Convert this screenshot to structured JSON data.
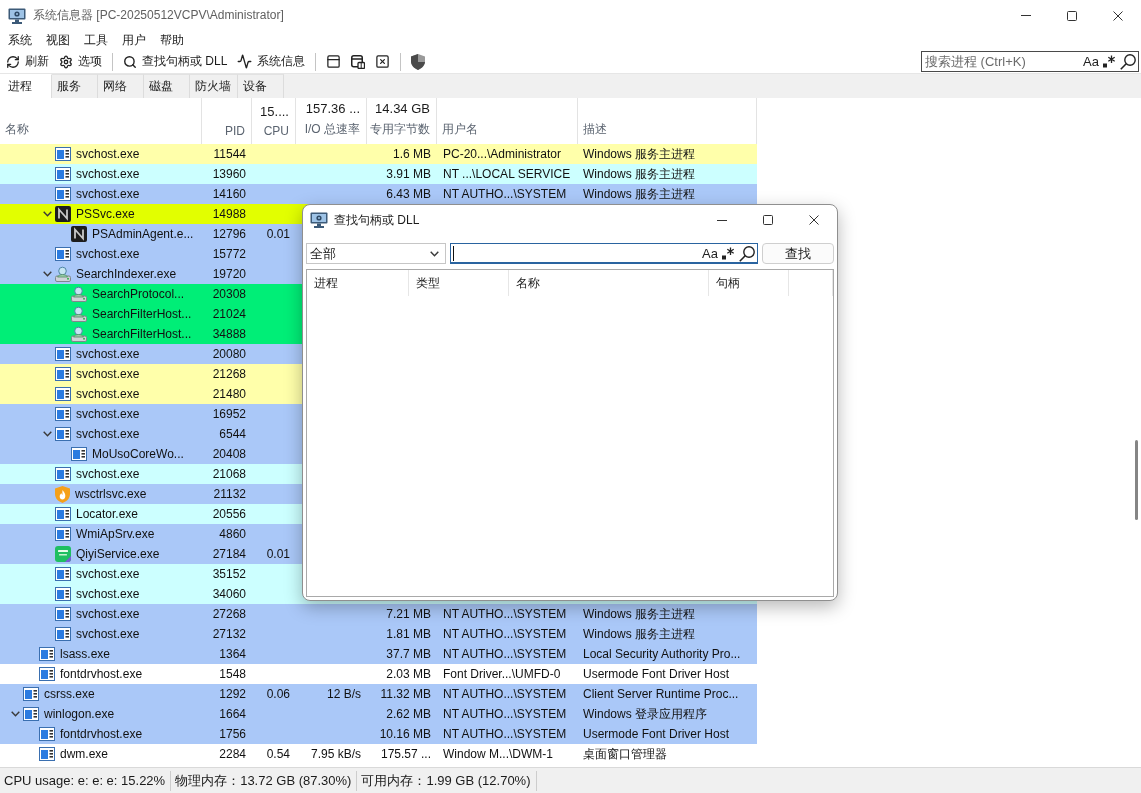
{
  "window": {
    "title": "系统信息器 [PC-20250512VCPV\\Administrator]"
  },
  "menu": [
    "系统",
    "视图",
    "工具",
    "用户",
    "帮助"
  ],
  "toolbar": [
    {
      "kind": "button",
      "label": "刷新"
    },
    {
      "kind": "button",
      "label": "选项"
    },
    {
      "kind": "separator"
    },
    {
      "kind": "button",
      "label": "查找句柄或 DLL"
    },
    {
      "kind": "button",
      "label": "系统信息"
    },
    {
      "kind": "separator"
    },
    {
      "kind": "icon"
    },
    {
      "kind": "icon"
    },
    {
      "kind": "icon"
    },
    {
      "kind": "separator"
    },
    {
      "kind": "icon"
    }
  ],
  "search": {
    "placeholder": "搜索进程 (Ctrl+K)",
    "case_toggle": "Aa"
  },
  "tabs": [
    {
      "label": "进程",
      "selected": true
    },
    {
      "label": "服务",
      "selected": false
    },
    {
      "label": "网络",
      "selected": false
    },
    {
      "label": "磁盘",
      "selected": false
    },
    {
      "label": "防火墙",
      "selected": false
    },
    {
      "label": "设备",
      "selected": false
    }
  ],
  "columns": [
    {
      "label": "名称"
    },
    {
      "label": "PID"
    },
    {
      "label": "CPU",
      "total": "15...."
    },
    {
      "label": "I/O 总速率",
      "total": "157.36 ..."
    },
    {
      "label": "专用字节数",
      "total": "14.34 GB"
    },
    {
      "label": "用户名"
    },
    {
      "label": "描述"
    }
  ],
  "rows": [
    {
      "children": [
        {
          "children": [
            {
              "name": "svchost.exe",
              "pid": "11544",
              "private_bytes": "1.6 MB",
              "user": "PC-20...\\Administrator",
              "description": "Windows 服务主进程",
              "color": "#ffffaa",
              "kind": "generic"
            },
            {
              "name": "svchost.exe",
              "pid": "13960",
              "private_bytes": "3.91 MB",
              "user": "NT ...\\LOCAL SERVICE",
              "description": "Windows 服务主进程",
              "color": "#ccffff",
              "kind": "generic"
            },
            {
              "name": "svchost.exe",
              "pid": "14160",
              "private_bytes": "6.43 MB",
              "user": "NT AUTHO...\\SYSTEM",
              "description": "Windows 服务主进程",
              "color": "#aac8f8",
              "kind": "generic"
            },
            {
              "name": "PSSvc.exe",
              "pid": "14988",
              "color": "#e2ff00",
              "kind": "letter",
              "expanded": true,
              "children": [
                {
                  "name": "PSAdminAgent.e...",
                  "pid": "12796",
                  "cpu": "0.01",
                  "color": "#aac8f8",
                  "kind": "letter"
                }
              ]
            },
            {
              "name": "svchost.exe",
              "pid": "15772",
              "color": "#aac8f8",
              "kind": "generic"
            },
            {
              "name": "SearchIndexer.exe",
              "pid": "19720",
              "color": "#aac8f8",
              "kind": "indexer",
              "expanded": true,
              "children": [
                {
                  "name": "SearchProtocol...",
                  "pid": "20308",
                  "color": "#00ee77",
                  "kind": "indexer"
                },
                {
                  "name": "SearchFilterHost...",
                  "pid": "21024",
                  "color": "#00ee77",
                  "kind": "indexer"
                },
                {
                  "name": "SearchFilterHost...",
                  "pid": "34888",
                  "color": "#00ee77",
                  "kind": "indexer"
                }
              ]
            },
            {
              "name": "svchost.exe",
              "pid": "20080",
              "color": "#aac8f8",
              "kind": "generic"
            },
            {
              "name": "svchost.exe",
              "pid": "21268",
              "color": "#ffffaa",
              "kind": "generic"
            },
            {
              "name": "svchost.exe",
              "pid": "21480",
              "color": "#ffffaa",
              "kind": "generic"
            },
            {
              "name": "svchost.exe",
              "pid": "16952",
              "color": "#aac8f8",
              "kind": "generic"
            },
            {
              "name": "svchost.exe",
              "pid": "6544",
              "color": "#aac8f8",
              "kind": "generic",
              "expanded": true,
              "children": [
                {
                  "name": "MoUsoCoreWo...",
                  "pid": "20408",
                  "color": "#aac8f8",
                  "kind": "generic"
                }
              ]
            },
            {
              "name": "svchost.exe",
              "pid": "21068",
              "color": "#ccffff",
              "kind": "generic"
            },
            {
              "name": "wsctrlsvc.exe",
              "pid": "21132",
              "color": "#aac8f8",
              "kind": "shield"
            },
            {
              "name": "Locator.exe",
              "pid": "20556",
              "color": "#ccffff",
              "kind": "generic"
            },
            {
              "name": "WmiApSrv.exe",
              "pid": "4860",
              "color": "#aac8f8",
              "kind": "generic"
            },
            {
              "name": "QiyiService.exe",
              "pid": "27184",
              "cpu": "0.01",
              "color": "#aac8f8",
              "kind": "tile"
            },
            {
              "name": "svchost.exe",
              "pid": "35152",
              "color": "#ccffff",
              "kind": "generic"
            },
            {
              "name": "svchost.exe",
              "pid": "34060",
              "color": "#ccffff",
              "kind": "generic"
            },
            {
              "name": "svchost.exe",
              "pid": "27268",
              "private_bytes": "7.21 MB",
              "user": "NT AUTHO...\\SYSTEM",
              "description": "Windows 服务主进程",
              "color": "#aac8f8",
              "kind": "generic"
            },
            {
              "name": "svchost.exe",
              "pid": "27132",
              "private_bytes": "1.81 MB",
              "user": "NT AUTHO...\\SYSTEM",
              "description": "Windows 服务主进程",
              "color": "#aac8f8",
              "kind": "generic"
            }
          ]
        },
        {
          "name": "lsass.exe",
          "pid": "1364",
          "private_bytes": "37.7 MB",
          "user": "NT AUTHO...\\SYSTEM",
          "description": "Local Security Authority Pro...",
          "color": "#aac8f8",
          "kind": "generic"
        },
        {
          "name": "fontdrvhost.exe",
          "pid": "1548",
          "private_bytes": "2.03 MB",
          "user": "Font Driver...\\UMFD-0",
          "description": "Usermode Font Driver Host",
          "color": "#ffffff",
          "kind": "generic"
        }
      ]
    },
    {
      "name": "csrss.exe",
      "pid": "1292",
      "cpu": "0.06",
      "io": "12 B/s",
      "private_bytes": "11.32 MB",
      "user": "NT AUTHO...\\SYSTEM",
      "description": "Client Server Runtime Proc...",
      "color": "#aac8f8",
      "kind": "generic"
    },
    {
      "name": "winlogon.exe",
      "pid": "1664",
      "private_bytes": "2.62 MB",
      "user": "NT AUTHO...\\SYSTEM",
      "description": "Windows 登录应用程序",
      "color": "#aac8f8",
      "kind": "generic",
      "expanded": true,
      "children": [
        {
          "name": "fontdrvhost.exe",
          "pid": "1756",
          "private_bytes": "10.16 MB",
          "user": "NT AUTHO...\\SYSTEM",
          "description": "Usermode Font Driver Host",
          "color": "#aac8f8",
          "kind": "generic"
        },
        {
          "name": "dwm.exe",
          "pid": "2284",
          "cpu": "0.54",
          "io": "7.95 kB/s",
          "private_bytes": "175.57 ...",
          "user": "Window M...\\DWM-1",
          "description": "桌面窗口管理器",
          "color": "#ffffff",
          "kind": "generic"
        }
      ]
    }
  ],
  "status_bar": [
    "CPU usage: e: e: e: 15.22%",
    "物理内存：13.72 GB (87.30%)",
    "可用内存：1.99 GB (12.70%)"
  ],
  "dialog": {
    "title": "查找句柄或 DLL",
    "filter": "全部",
    "search": {
      "focused": true,
      "case_toggle": "Aa"
    },
    "button": "查找",
    "columns": [
      "进程",
      "类型",
      "名称",
      "句柄"
    ]
  }
}
